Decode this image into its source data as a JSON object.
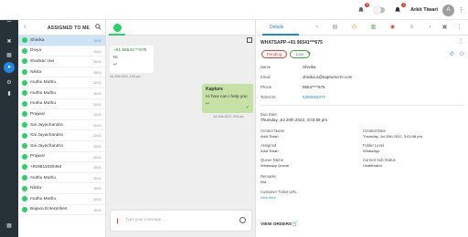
{
  "topbar": {
    "notification_count_1": "5",
    "notification_count_2": "1",
    "user_name": "Arkit Tiwari",
    "avatar_initial": "A"
  },
  "conversations": {
    "title": "ASSIGNED TO ME",
    "items": [
      {
        "name": "Shivika",
        "time": "15:01"
      },
      {
        "name": "Divya",
        "time": "15:01"
      },
      {
        "name": "shankar ravi",
        "time": "15:01"
      },
      {
        "name": "Nikita",
        "time": "15:01"
      },
      {
        "name": "muthu Muthu",
        "time": "15:01"
      },
      {
        "name": "muthu Muthu",
        "time": "15:01"
      },
      {
        "name": "muthu Muthu",
        "time": "15:01"
      },
      {
        "name": "Prajwal",
        "time": "15:01"
      },
      {
        "name": "Sai Jayachandra",
        "time": "15:01"
      },
      {
        "name": "Sai Jayachandra",
        "time": "15:01"
      },
      {
        "name": "Sai Jayachandra",
        "time": "15:01"
      },
      {
        "name": "Prajwal",
        "time": "15:01"
      },
      {
        "name": "+919811030464",
        "time": "15:01"
      },
      {
        "name": "muthu Muthu",
        "time": "15:01"
      },
      {
        "name": "Nikita",
        "time": "15:01"
      },
      {
        "name": "muthu Muthu",
        "time": "15:01"
      },
      {
        "name": "Bajaxa Enterprises",
        "time": "15:01"
      }
    ]
  },
  "chat": {
    "incoming": {
      "phone": "+91 96541***675",
      "text": "Hi",
      "timestamp": "Jul 20th 2022, 3:03 pm"
    },
    "outgoing": {
      "name": "Kapture",
      "text": "Hi how can i help you",
      "timestamp": "Jul 20th 2022, 3:03 pm"
    },
    "input_placeholder": "Type your message..."
  },
  "details": {
    "tab_label": "Details",
    "title": "WHATSAPP-+91 96541***675",
    "status": "Pending",
    "priority": "Low",
    "name_label": "Name",
    "name_value": "Shivika",
    "email_label": "Email",
    "email_value": "shivika.a@kapturecrm.com",
    "phone_label": "Phone",
    "phone_value": "9654****675",
    "ticket_label": "Ticket ID",
    "ticket_value": "5300058377",
    "due_label": "Due Date",
    "due_value": "Thursday, Jul 20th 2022, 3:03:58 pm",
    "creator_label": "Creator Name",
    "creator_value": "Arkit Tiwari",
    "created_label": "Created Date",
    "created_value": "Thursday, Jul 20th 2022, 3:03:58 pm",
    "assigned_label": "Assigned",
    "assigned_value": "Arkit Tiwari",
    "folder_label": "Folder Level",
    "folder_value": "WhatsApp",
    "queue_label": "Queue Name",
    "queue_value": "Whatsapp Queue",
    "substatus_label": "Current Sub Status",
    "substatus_value": "Unattended",
    "remarks_label": "Remarks",
    "remarks_value": "N/a",
    "url_label": "Customer Ticket URL",
    "url_value": "click here",
    "view_orders": "VIEW ORDERS"
  }
}
